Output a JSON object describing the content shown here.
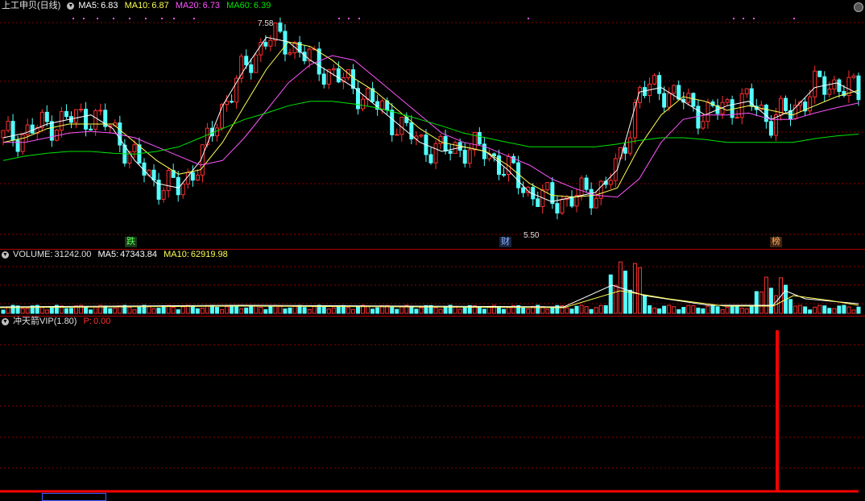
{
  "price_header": {
    "stock_name": "上工申贝",
    "period": "(日线)",
    "ma5_label": "MA5:",
    "ma5_value": "6.83",
    "ma10_label": "MA10:",
    "ma10_value": "6.87",
    "ma20_label": "MA20:",
    "ma20_value": "6.73",
    "ma60_label": "MA60:",
    "ma60_value": "6.39"
  },
  "volume_header": {
    "volume_label": "VOLUME:",
    "volume_value": "31242.00",
    "ma5_label": "MA5:",
    "ma5_value": "47343.84",
    "ma10_label": "MA10:",
    "ma10_value": "62919.98"
  },
  "indicator_header": {
    "name": "冲天箭VIP(1.80)",
    "p_label": "P:",
    "p_value": "0.00"
  },
  "annotations": {
    "high_price": "7.58",
    "low_price": "5.50",
    "marker_1": "跌",
    "marker_2": "财",
    "marker_3": "榜"
  },
  "colors": {
    "up": "#ff3030",
    "down": "#54ffff",
    "ma5": "#ffffff",
    "ma10": "#ffff54",
    "ma20": "#ff54ff",
    "ma60": "#00e600",
    "grid": "#8b0000",
    "signal": "#ff0000"
  },
  "chart_data": {
    "type": "candlestick",
    "title": "",
    "ylim": [
      5.3,
      7.7
    ],
    "series": [
      {
        "name": "MA5",
        "values": [
          6.35,
          6.4,
          6.5,
          6.55,
          6.6,
          6.45,
          6.1,
          5.85,
          5.8,
          6.1,
          6.7,
          7.1,
          7.45,
          7.4,
          7.2,
          7.05,
          6.9,
          6.7,
          6.5,
          6.3,
          6.2,
          6.25,
          6.2,
          6.0,
          5.75,
          5.65,
          5.7,
          5.75,
          6.0,
          6.85,
          6.9,
          6.75,
          6.6,
          6.7,
          6.75,
          6.55,
          6.65,
          6.9,
          6.95,
          6.83
        ]
      },
      {
        "name": "MA10",
        "values": [
          6.3,
          6.35,
          6.45,
          6.5,
          6.5,
          6.5,
          6.3,
          6.1,
          5.95,
          6.0,
          6.3,
          6.7,
          7.1,
          7.4,
          7.35,
          7.2,
          7.0,
          6.85,
          6.65,
          6.45,
          6.3,
          6.25,
          6.2,
          6.05,
          5.85,
          5.72,
          5.7,
          5.72,
          5.8,
          6.25,
          6.6,
          6.8,
          6.75,
          6.65,
          6.7,
          6.65,
          6.6,
          6.7,
          6.8,
          6.87
        ]
      },
      {
        "name": "MA20",
        "values": [
          6.3,
          6.3,
          6.35,
          6.4,
          6.42,
          6.4,
          6.35,
          6.25,
          6.15,
          6.05,
          6.1,
          6.35,
          6.65,
          6.95,
          7.15,
          7.25,
          7.2,
          7.0,
          6.8,
          6.6,
          6.4,
          6.3,
          6.25,
          6.15,
          6.05,
          5.9,
          5.8,
          5.72,
          5.7,
          5.9,
          6.3,
          6.55,
          6.6,
          6.6,
          6.62,
          6.55,
          6.55,
          6.62,
          6.68,
          6.73
        ]
      },
      {
        "name": "MA60",
        "values": [
          6.1,
          6.15,
          6.18,
          6.2,
          6.2,
          6.18,
          6.17,
          6.2,
          6.25,
          6.35,
          6.45,
          6.55,
          6.62,
          6.7,
          6.75,
          6.75,
          6.72,
          6.68,
          6.62,
          6.55,
          6.48,
          6.4,
          6.35,
          6.3,
          6.25,
          6.25,
          6.25,
          6.25,
          6.28,
          6.32,
          6.35,
          6.35,
          6.33,
          6.3,
          6.3,
          6.3,
          6.3,
          6.34,
          6.37,
          6.39
        ]
      }
    ]
  }
}
